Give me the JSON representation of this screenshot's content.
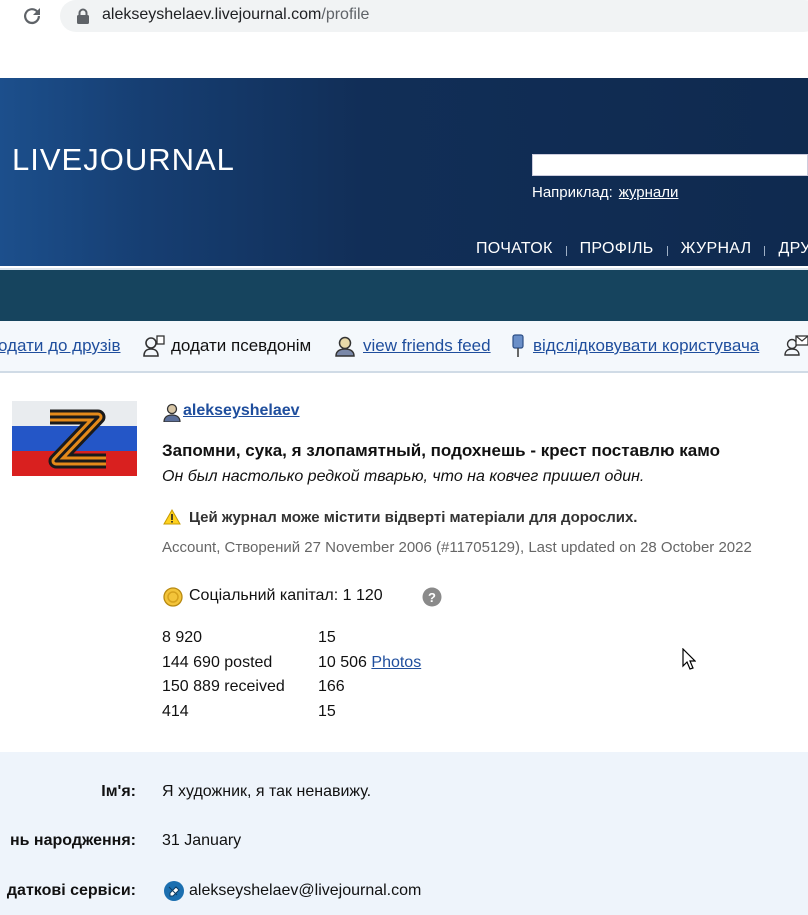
{
  "browser": {
    "url_host": "alekseyshelaev.livejournal.com",
    "url_path": "/profile"
  },
  "header": {
    "logo": "LIVEJOURNAL",
    "search_example_label": "Наприклад:",
    "search_example_link": "журнали",
    "nav": [
      "ПОЧАТОК",
      "ПРОФІЛЬ",
      "ЖУРНАЛ",
      "ДРУ"
    ]
  },
  "actions": {
    "add_friend": "одати до друзів",
    "add_alias": "додати псевдонім",
    "view_feed": "view friends feed",
    "track_user": "відслідковувати користувача"
  },
  "profile": {
    "username": "alekseyshelaev",
    "journal_title": "Запомни, сука, я злопамятный, подохнешь - крест поставлю камо",
    "journal_subtitle": "Он был настолько редкой тварью, что на ковчег пришел один.",
    "adult_warning": "Цей журнал може містити відверті матеріали для дорослих.",
    "account_info": "Account, Створений 27 November 2006 (#11705129),  Last updated on 28 October 2022",
    "social_capital": "Соціальний капітал: 1  120",
    "stats": [
      {
        "left": "8  920",
        "right": "15",
        "right_link": ""
      },
      {
        "left": "144  690 posted",
        "right": "10  506 ",
        "right_link": "Photos"
      },
      {
        "left": "150  889 received",
        "right": "166",
        "right_link": ""
      },
      {
        "left": "414",
        "right": "15",
        "right_link": ""
      }
    ]
  },
  "details": {
    "name_label": "Ім'я:",
    "name_value": "Я художник, я так ненавижу.",
    "birthday_label": "нь народження:",
    "birthday_value": "31 January",
    "services_label": "даткові сервіси:",
    "services_value": "alekseyshelaev@livejournal.com"
  },
  "colors": {
    "header_dark": "#0f2a4f",
    "teal_band": "#16445e",
    "link": "#1f4e9d",
    "details_bg": "#eef4fb"
  },
  "icons": [
    "reload-icon",
    "lock-icon",
    "alias-icon",
    "friends-feed-icon",
    "pin-icon",
    "mail-icon",
    "person-icon",
    "warning-icon",
    "coin-icon",
    "help-icon",
    "cursor-icon",
    "email-service-icon"
  ]
}
